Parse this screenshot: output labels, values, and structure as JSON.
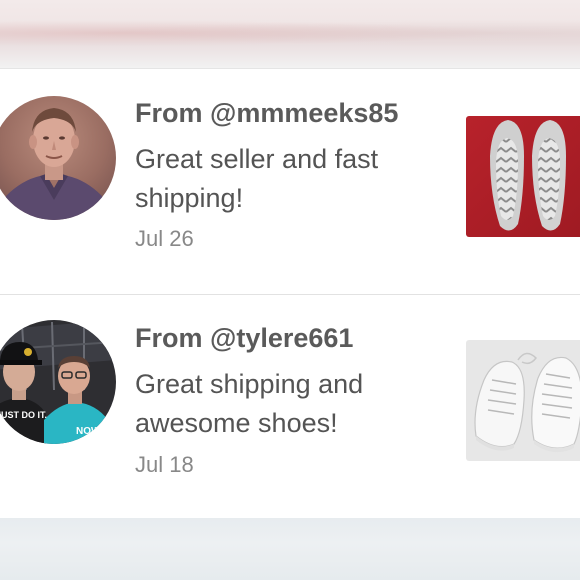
{
  "reviews": [
    {
      "from": "From @mmmeeks85",
      "comment": "Great seller and fast shipping!",
      "date": "Jul 26",
      "avatar_icon": "avatar-older-man",
      "thumbnail_icon": "gray-chevron-flats-on-red"
    },
    {
      "from": "From @tylere661",
      "comment": "Great shipping and awesome shoes!",
      "date": "Jul 18",
      "avatar_icon": "avatar-two-men",
      "thumbnail_icon": "white-sneakers"
    }
  ],
  "thumb_text": {
    "shirt_left": "JUST DO IT.",
    "shirt_right": "NOW"
  },
  "colors": {
    "username_text": "#5a5a5a",
    "comment_text": "#545454",
    "date_text": "#888888",
    "divider": "#e2e2e2",
    "card_background": "#ffffff"
  }
}
